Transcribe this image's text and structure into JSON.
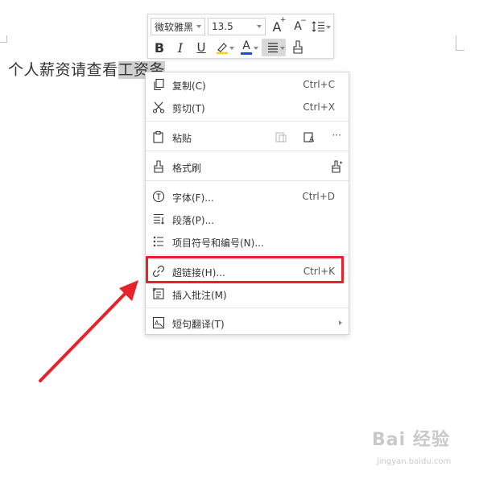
{
  "document": {
    "text_before": "个人薪资请查看",
    "text_selected": "工资条"
  },
  "mini_toolbar": {
    "font_name": "微软雅黑",
    "font_size": "13.5",
    "bold_label": "B",
    "italic_label": "I",
    "underline_label": "U",
    "font_color_label": "A",
    "font_color": "#1a4fd6",
    "grow_font_label": "A",
    "shrink_font_label": "A"
  },
  "context_menu": {
    "items": [
      {
        "label": "复制(C)",
        "shortcut": "Ctrl+C",
        "icon": "copy-icon"
      },
      {
        "label": "剪切(T)",
        "shortcut": "Ctrl+X",
        "icon": "scissors-icon"
      },
      {
        "label": "粘贴",
        "shortcut": "",
        "icon": "paste-icon"
      },
      {
        "label": "格式刷",
        "shortcut": "",
        "icon": "format-painter-icon"
      },
      {
        "label": "字体(F)...",
        "shortcut": "Ctrl+D",
        "icon": "font-icon"
      },
      {
        "label": "段落(P)...",
        "shortcut": "",
        "icon": "paragraph-icon"
      },
      {
        "label": "项目符号和编号(N)...",
        "shortcut": "",
        "icon": "bullet-list-icon"
      },
      {
        "label": "超链接(H)...",
        "shortcut": "Ctrl+K",
        "icon": "link-icon"
      },
      {
        "label": "插入批注(M)",
        "shortcut": "",
        "icon": "comment-icon"
      },
      {
        "label": "短句翻译(T)",
        "shortcut": "",
        "icon": "translate-icon"
      }
    ],
    "paste_more_label": "···"
  },
  "annotation": {
    "highlight_color": "#e8222c"
  },
  "watermark": {
    "text": "Bai 经验",
    "sub": "jingyan.baidu.com"
  }
}
